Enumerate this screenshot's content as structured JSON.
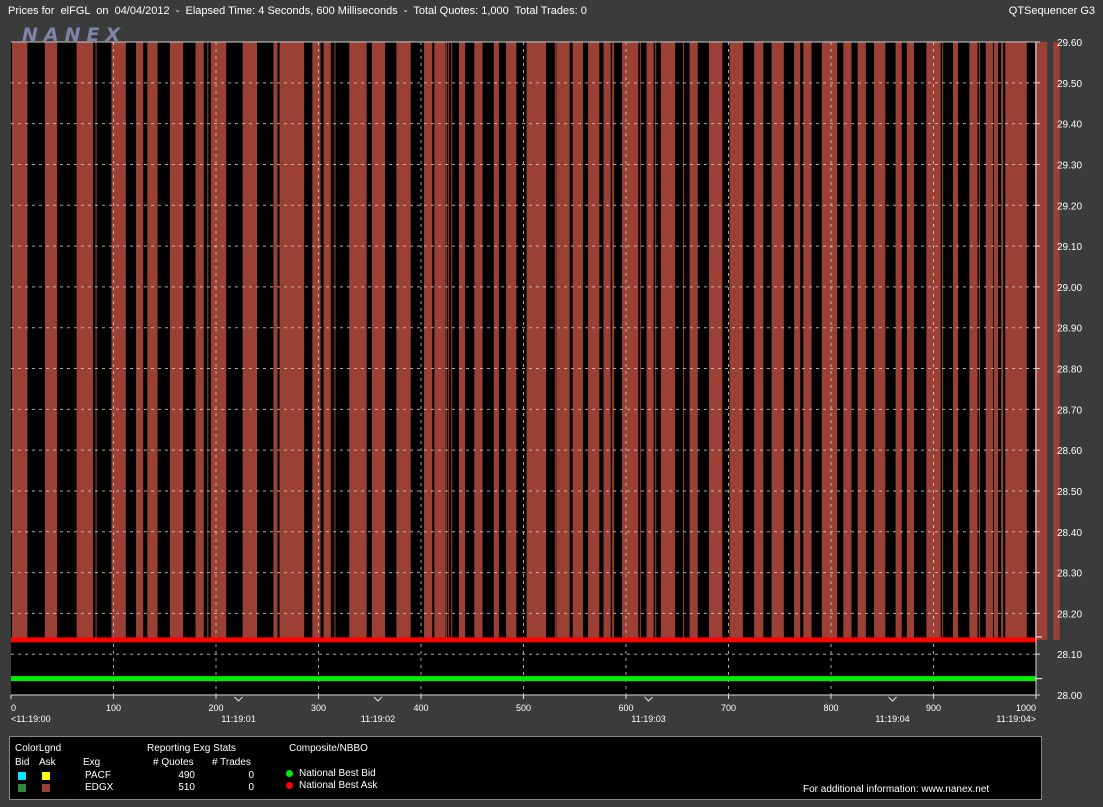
{
  "window": {
    "title_left": "Prices for  elFGL  on  04/04/2012  -  Elapsed Time: 4 Seconds, 600 Milliseconds  -  Total Quotes: 1,000  Total Trades: 0",
    "title_right": "QTSequencer G3",
    "logo": "NANEX"
  },
  "colors": {
    "background": "#3b3b3b",
    "plot_bg": "#000000",
    "edgx_ask": "#9a4035",
    "best_ask": "#ff0000",
    "best_bid": "#00ee00",
    "pacf_bid": "#00e5ff",
    "pacf_ask": "#ffff00",
    "edgx_bid": "#2e8b3e"
  },
  "chart_data": {
    "type": "area",
    "x_range": [
      0,
      1000
    ],
    "ylim": [
      28.0,
      29.6
    ],
    "yticks": [
      "28.00",
      "28.10",
      "28.20",
      "28.30",
      "28.40",
      "28.50",
      "28.60",
      "28.70",
      "28.80",
      "28.90",
      "29.00",
      "29.10",
      "29.20",
      "29.30",
      "29.40",
      "29.50",
      "29.60"
    ],
    "xticks": [
      0,
      100,
      200,
      300,
      400,
      500,
      600,
      700,
      800,
      900,
      1000
    ],
    "time_labels": [
      {
        "x": 0,
        "label": "<11:19:00"
      },
      {
        "x": 222,
        "label": "11:19:01"
      },
      {
        "x": 358,
        "label": "11:19:02"
      },
      {
        "x": 622,
        "label": "11:19:03"
      },
      {
        "x": 860,
        "label": "11:19:04"
      },
      {
        "x": 1000,
        "label": "11:19:04>"
      }
    ],
    "series": [
      {
        "name": "National Best Ask",
        "type": "line",
        "value": 28.135
      },
      {
        "name": "National Best Bid",
        "type": "line",
        "value": 28.04
      },
      {
        "name": "EDGX",
        "type": "ask_segments",
        "value": 29.6,
        "segments": [
          [
            1,
            16
          ],
          [
            33,
            45
          ],
          [
            64,
            80
          ],
          [
            98,
            112
          ],
          [
            122,
            129
          ],
          [
            133,
            143
          ],
          [
            155,
            168
          ],
          [
            180,
            188
          ],
          [
            195,
            210
          ],
          [
            226,
            240
          ],
          [
            256,
            260
          ],
          [
            262,
            286
          ],
          [
            294,
            302
          ],
          [
            305,
            312
          ],
          [
            330,
            347
          ],
          [
            352,
            365
          ],
          [
            376,
            390
          ],
          [
            403,
            411
          ],
          [
            413,
            424
          ],
          [
            437,
            443
          ],
          [
            452,
            460
          ],
          [
            471,
            476
          ],
          [
            483,
            493
          ],
          [
            503,
            522
          ],
          [
            532,
            545
          ],
          [
            548,
            558
          ],
          [
            563,
            574
          ],
          [
            578,
            585
          ],
          [
            596,
            612
          ],
          [
            620,
            627
          ],
          [
            634,
            648
          ],
          [
            662,
            670
          ],
          [
            681,
            694
          ],
          [
            701,
            714
          ],
          [
            725,
            734
          ],
          [
            742,
            754
          ],
          [
            764,
            770
          ],
          [
            773,
            781
          ],
          [
            791,
            806
          ],
          [
            812,
            820
          ],
          [
            826,
            834
          ],
          [
            842,
            853
          ],
          [
            863,
            869
          ],
          [
            874,
            881
          ],
          [
            893,
            907
          ],
          [
            919,
            924
          ],
          [
            935,
            943
          ],
          [
            951,
            958
          ],
          [
            959,
            963
          ],
          [
            966,
            968
          ],
          [
            970,
            991
          ],
          [
            999,
            1011
          ],
          [
            1017,
            1023
          ]
        ],
        "line_marks": [
          83,
          192,
          277,
          281,
          283,
          316,
          425,
          427,
          430,
          531,
          587,
          588,
          614,
          629,
          656,
          844,
          909,
          945
        ]
      }
    ]
  },
  "legend": {
    "colorlgnd": {
      "header": "ColorLgnd",
      "bid_label": "Bid",
      "ask_label": "Ask",
      "exg_label": "Exg",
      "exchanges": [
        "PACF",
        "EDGX"
      ]
    },
    "stats": {
      "header": "Reporting Exg Stats",
      "quotes_label": "# Quotes",
      "trades_label": "# Trades",
      "rows": [
        {
          "quotes": "490",
          "trades": "0"
        },
        {
          "quotes": "510",
          "trades": "0"
        }
      ]
    },
    "nbbo": {
      "header": "Composite/NBBO",
      "bid_label": "National Best Bid",
      "ask_label": "National Best Ask"
    },
    "footer": "For additional information: www.nanex.net"
  }
}
